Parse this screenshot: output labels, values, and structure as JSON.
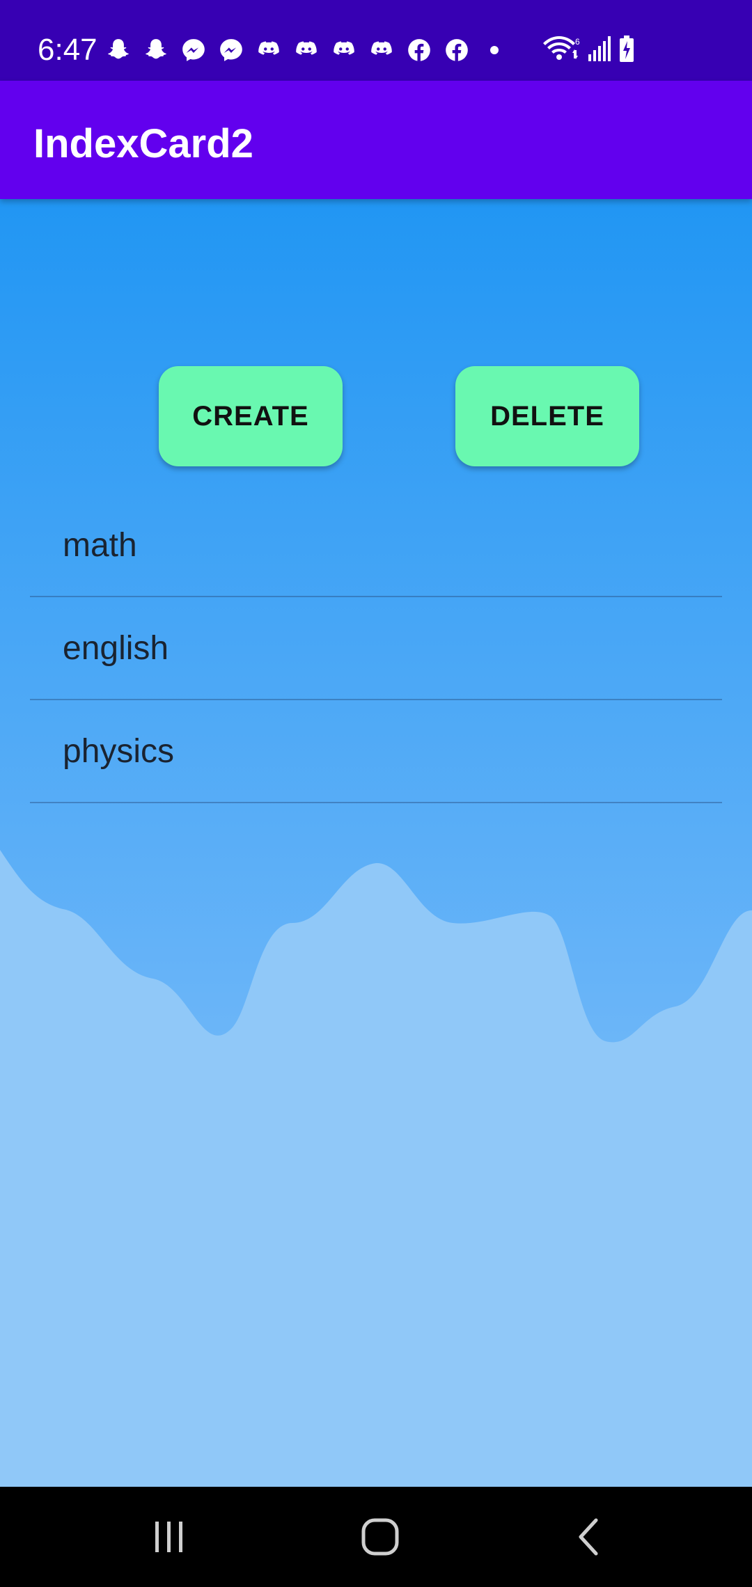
{
  "status_bar": {
    "time": "6:47",
    "notification_icons": [
      "snapchat-icon",
      "snapchat-icon",
      "messenger-icon",
      "messenger-icon",
      "discord-icon",
      "discord-icon",
      "discord-icon",
      "discord-icon",
      "facebook-icon",
      "facebook-icon"
    ],
    "system_icons": [
      "wifi-icon",
      "signal-icon",
      "battery-charging-icon"
    ],
    "wifi_label": "6"
  },
  "app_bar": {
    "title": "IndexCard2",
    "color": "#6200ee"
  },
  "buttons": {
    "create_label": "CREATE",
    "delete_label": "DELETE",
    "color": "#69f8b0"
  },
  "list": {
    "items": [
      {
        "label": "math"
      },
      {
        "label": "english"
      },
      {
        "label": "physics"
      }
    ]
  },
  "nav_bar": {
    "icons": [
      "recents-icon",
      "home-icon",
      "back-icon"
    ]
  },
  "colors": {
    "status_bar": "#3700b3",
    "background_top": "#2196f3",
    "background_bottom": "#90c8f8"
  }
}
